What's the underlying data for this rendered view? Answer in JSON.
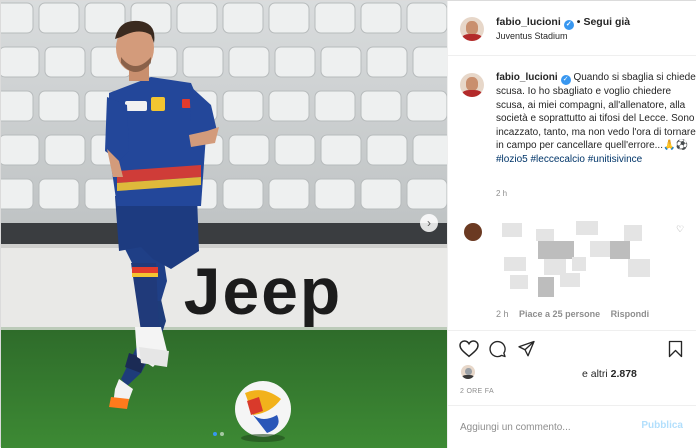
{
  "header": {
    "username": "fabio_lucioni",
    "follow_label": "Segui già",
    "location": "Juventus Stadium",
    "more_glyph": "•••"
  },
  "photo": {
    "billboard_text": "Jeep",
    "next_glyph": "›",
    "carousel_dots": 2,
    "active_dot": 0
  },
  "caption": {
    "username": "fabio_lucioni",
    "text": "Quando si sbaglia si chiede scusa. Io ho sbagliato e voglio chiedere scusa, ai miei compagni, all'allenatore, alla società e soprattutto ai tifosi del Lecce. Sono incazzato, tanto, ma non vedo l'ora di tornare in campo per cancellare quell'errore...🙏⚽",
    "hashtags": "#lozio5 #leccecalcio #unitisivince",
    "time": "2 h"
  },
  "comment": {
    "time": "2 h",
    "likes": "Piace a 25 persone",
    "reply_label": "Rispondi",
    "heart_glyph": "♡"
  },
  "actions": {
    "like_icon": "heart-icon",
    "comment_icon": "comment-icon",
    "share_icon": "share-icon",
    "save_icon": "bookmark-icon"
  },
  "likes": {
    "prefix": "e altri",
    "count": "2.878",
    "post_time": "2 ORE FA"
  },
  "add_comment": {
    "placeholder": "Aggiungi un commento...",
    "publish_label": "Pubblica"
  },
  "colors": {
    "link_blue": "#003569",
    "verified_blue": "#3897f0",
    "publish_disabled": "#b2dffc",
    "muted_text": "#8e8e8e"
  }
}
